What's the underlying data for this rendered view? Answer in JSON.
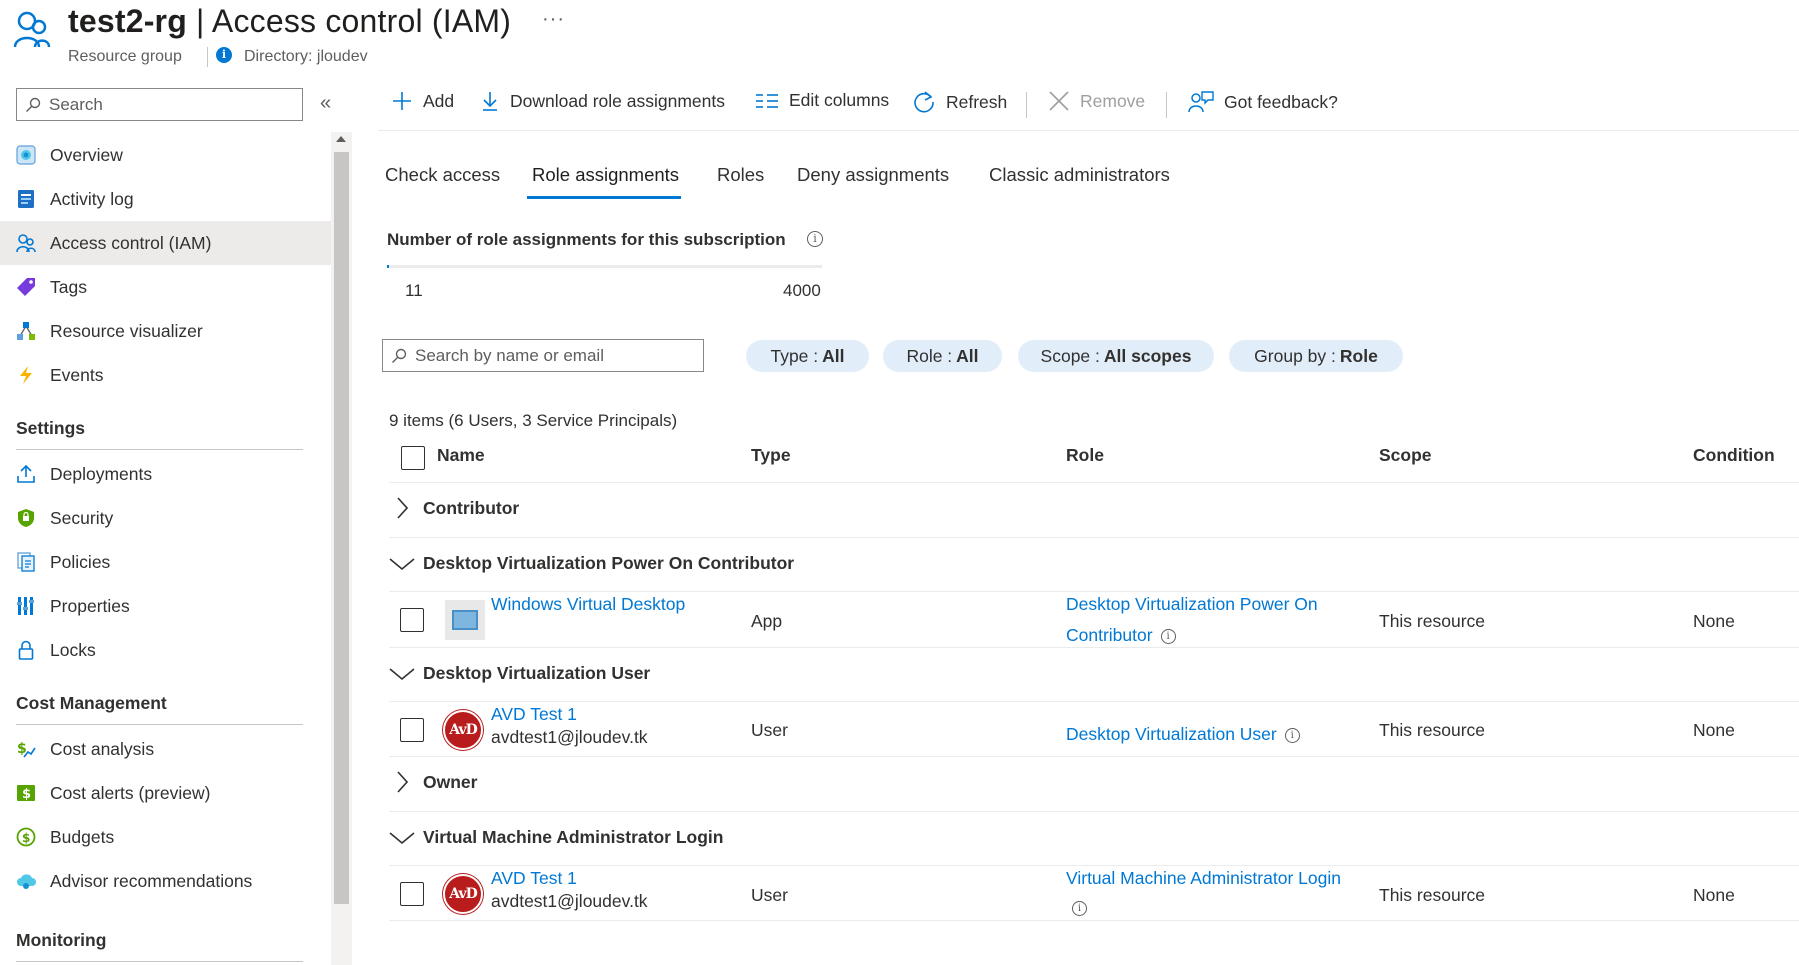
{
  "header": {
    "resource_name": "test2-rg",
    "separator": " | ",
    "page_title": "Access control (IAM)",
    "more": "···",
    "resource_type": "Resource group",
    "directory": "Directory: jloudev"
  },
  "sidebar": {
    "search_placeholder": "Search",
    "collapse": "«",
    "items": [
      {
        "label": "Overview",
        "icon": "overview-icon"
      },
      {
        "label": "Activity log",
        "icon": "activity-log-icon"
      },
      {
        "label": "Access control (IAM)",
        "icon": "iam-icon",
        "active": true
      },
      {
        "label": "Tags",
        "icon": "tag-icon"
      },
      {
        "label": "Resource visualizer",
        "icon": "resource-visualizer-icon"
      },
      {
        "label": "Events",
        "icon": "events-icon"
      }
    ],
    "sections": [
      {
        "title": "Settings",
        "items": [
          {
            "label": "Deployments",
            "icon": "deployments-icon"
          },
          {
            "label": "Security",
            "icon": "security-icon"
          },
          {
            "label": "Policies",
            "icon": "policies-icon"
          },
          {
            "label": "Properties",
            "icon": "properties-icon"
          },
          {
            "label": "Locks",
            "icon": "lock-icon"
          }
        ]
      },
      {
        "title": "Cost Management",
        "items": [
          {
            "label": "Cost analysis",
            "icon": "cost-analysis-icon"
          },
          {
            "label": "Cost alerts (preview)",
            "icon": "cost-alerts-icon"
          },
          {
            "label": "Budgets",
            "icon": "budgets-icon"
          },
          {
            "label": "Advisor recommendations",
            "icon": "advisor-icon"
          }
        ]
      },
      {
        "title": "Monitoring",
        "items": []
      }
    ]
  },
  "toolbar": {
    "add": "Add",
    "download": "Download role assignments",
    "edit_columns": "Edit columns",
    "refresh": "Refresh",
    "remove": "Remove",
    "feedback": "Got feedback?"
  },
  "tabs": [
    "Check access",
    "Role assignments",
    "Roles",
    "Deny assignments",
    "Classic administrators"
  ],
  "selected_tab": "Role assignments",
  "count": {
    "title": "Number of role assignments for this subscription",
    "current": 11,
    "max": 4000,
    "current_label": "11",
    "max_label": "4000"
  },
  "filters": {
    "search_placeholder": "Search by name or email",
    "type_label": "Type :",
    "type_value": "All",
    "role_label": "Role :",
    "role_value": "All",
    "scope_label": "Scope :",
    "scope_value": "All scopes",
    "group_label": "Group by :",
    "group_value": "Role"
  },
  "grid": {
    "summary": "9 items (6 Users, 3 Service Principals)",
    "columns": {
      "name": "Name",
      "type": "Type",
      "role": "Role",
      "scope": "Scope",
      "condition": "Condition"
    },
    "groups": [
      {
        "label": "Contributor",
        "expanded": false
      },
      {
        "label": "Desktop Virtualization Power On Contributor",
        "expanded": true
      },
      {
        "label": "Desktop Virtualization User",
        "expanded": true
      },
      {
        "label": "Owner",
        "expanded": false
      },
      {
        "label": "Virtual Machine Administrator Login",
        "expanded": true
      }
    ],
    "rows": [
      {
        "name": "Windows Virtual Desktop",
        "email": "",
        "type": "App",
        "role_line1": "Desktop Virtualization Power On",
        "role_line2": "Contributor",
        "scope": "This resource",
        "condition": "None",
        "avatar": "app"
      },
      {
        "name": "AVD Test 1",
        "email": "avdtest1@jloudev.tk",
        "type": "User",
        "role_line1": "Desktop Virtualization User",
        "role_line2": "",
        "scope": "This resource",
        "condition": "None",
        "avatar": "user",
        "avatar_text": "AvD"
      },
      {
        "name": "AVD Test 1",
        "email": "avdtest1@jloudev.tk",
        "type": "User",
        "role_line1": "Virtual Machine Administrator Login",
        "role_line2": "",
        "scope": "This resource",
        "condition": "None",
        "avatar": "user",
        "avatar_text": "AvD"
      }
    ]
  },
  "colors": {
    "accent": "#0078d4",
    "pill_bg": "#e1eefa",
    "active_nav": "#edebe9"
  }
}
